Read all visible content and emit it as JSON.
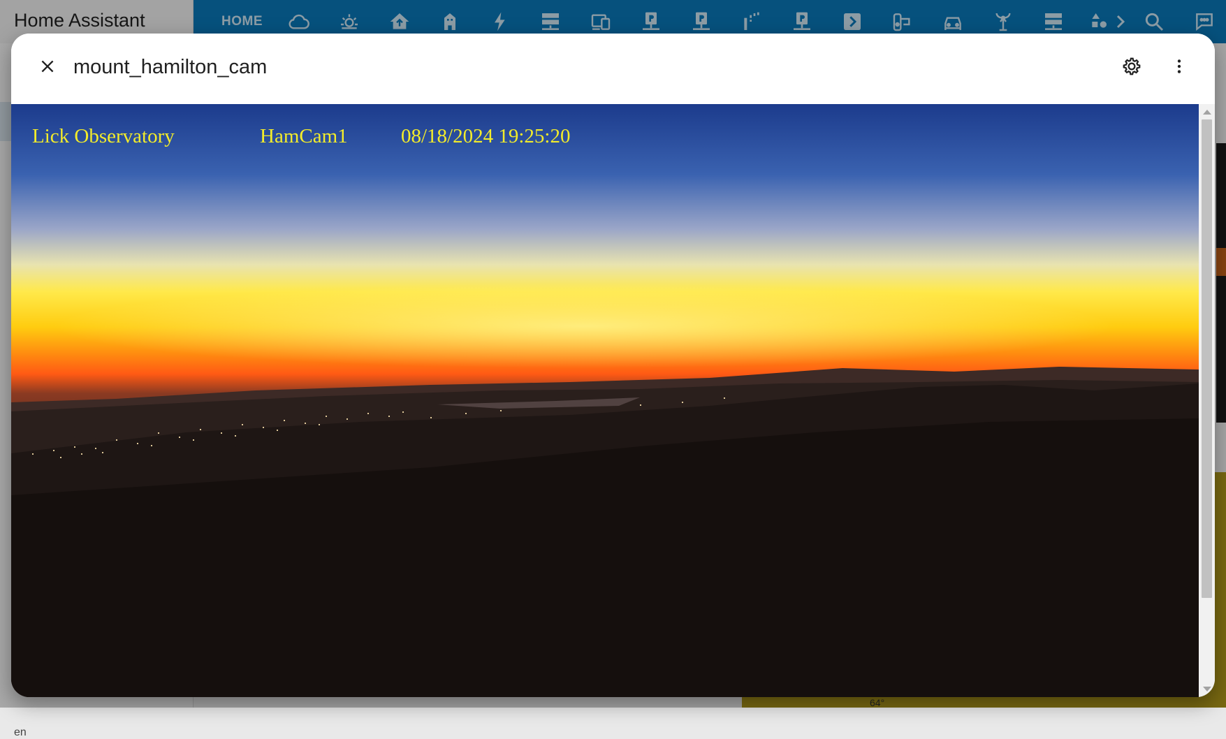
{
  "app": {
    "title": "Home Assistant"
  },
  "toolbar": {
    "home_tab": "HOME",
    "icons": [
      "weather-cloudy-icon",
      "weather-sunset-icon",
      "home-smart-icon",
      "building-icon",
      "lightning-icon",
      "server-icon",
      "devices-icon",
      "network-p-icon",
      "network-p-icon-2",
      "signal-icon",
      "network-p-icon-3",
      "chevron-box-icon",
      "heat-pump-icon",
      "car-icon",
      "antenna-icon",
      "server-icon-2",
      "shapes-icon",
      "chevron-right-icon",
      "search-icon",
      "assist-message-icon"
    ]
  },
  "background": {
    "sidebar_footer_text": "en",
    "map_label": "64°"
  },
  "dialog": {
    "title": "mount_hamilton_cam",
    "close_label": "Close",
    "settings_label": "Settings",
    "menu_label": "More options"
  },
  "camera": {
    "overlay_left": "Lick  Observatory",
    "overlay_mid": "HamCam1",
    "overlay_right": "08/18/2024  19:25:20"
  },
  "colors": {
    "toolbar": "#0a78b9",
    "overlay_text": "#f3ec2a",
    "sky_top": "#1f3f8f",
    "horizon_glow": "#ffd51a",
    "horizon_orange": "#ff6a10"
  }
}
